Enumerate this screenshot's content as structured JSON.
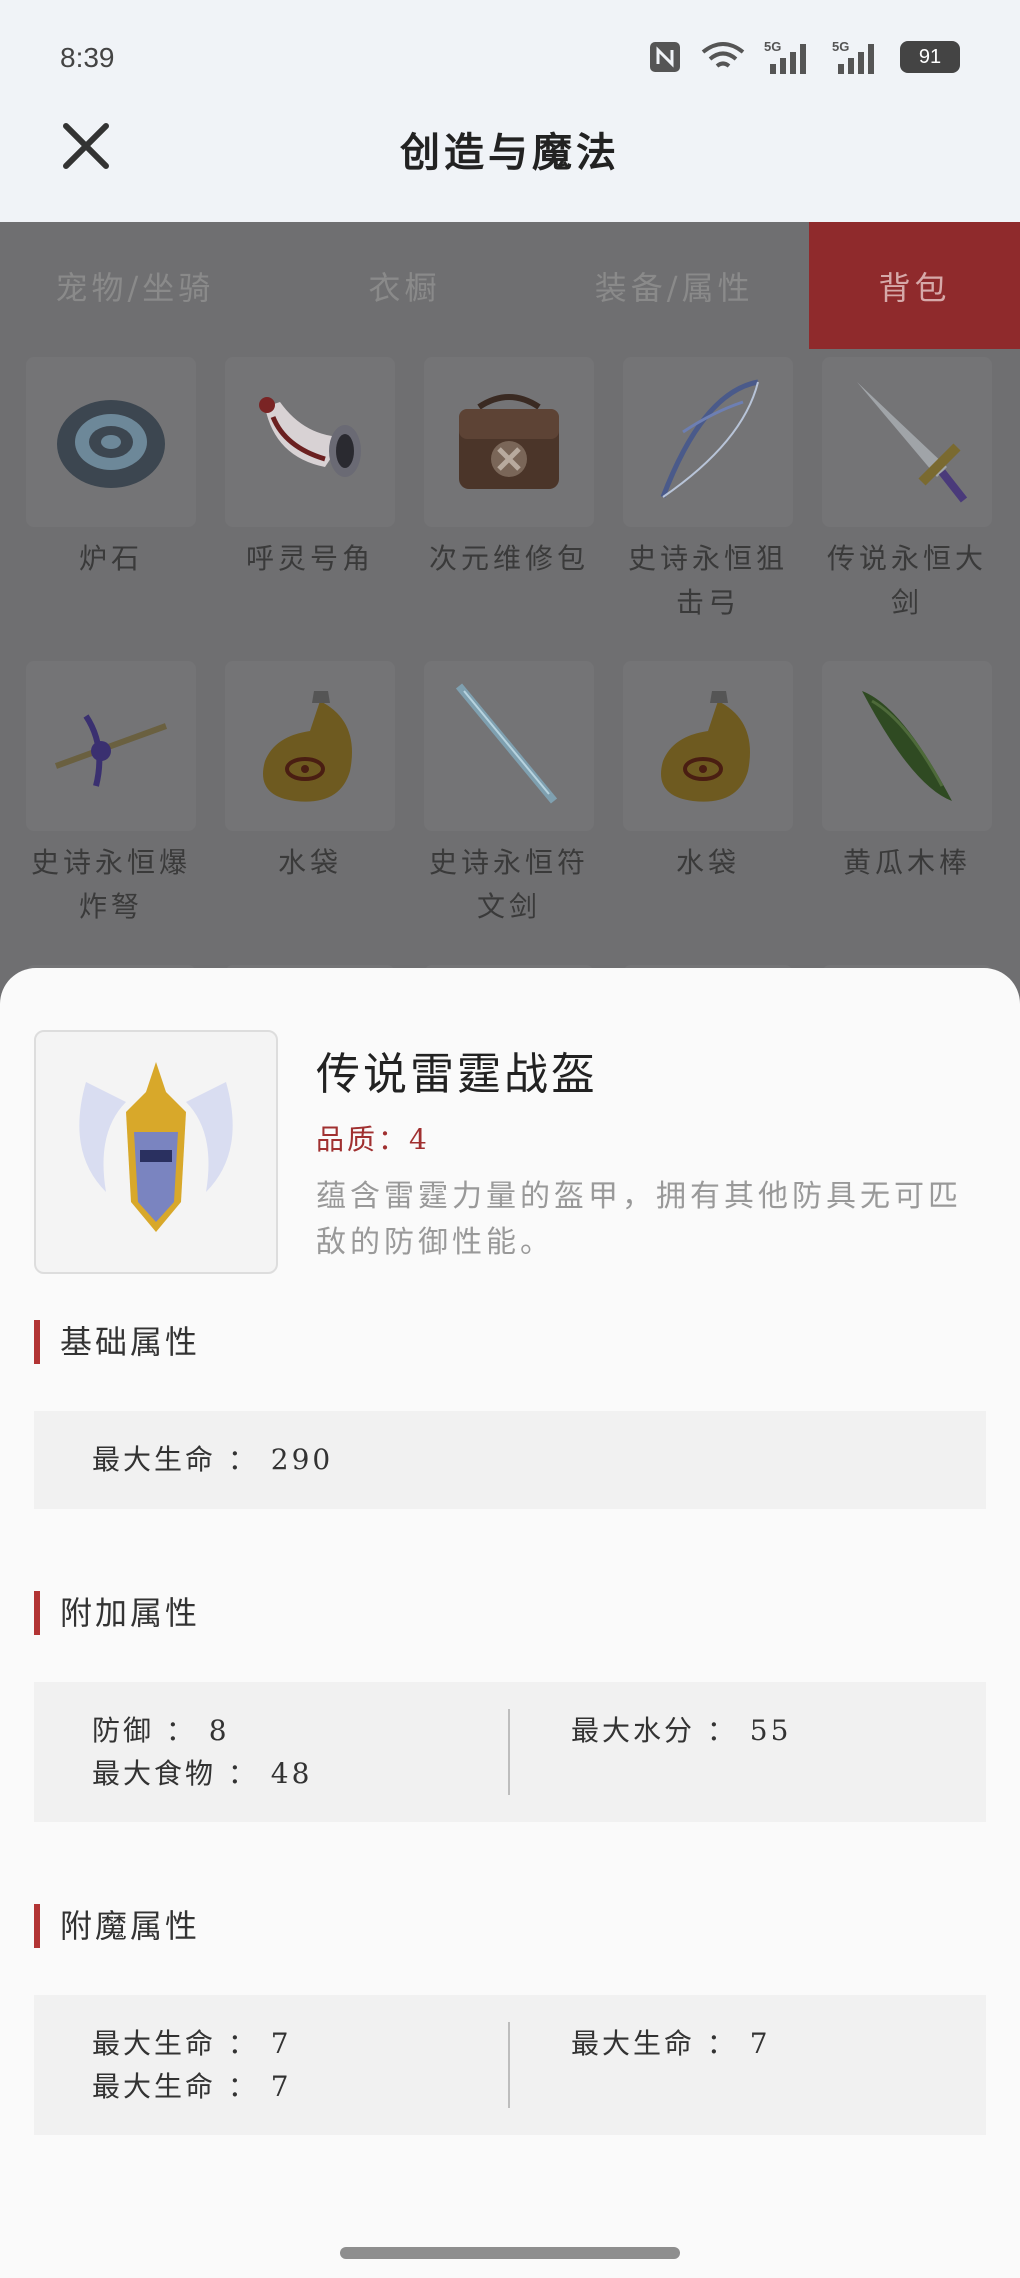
{
  "status": {
    "time": "8:39",
    "battery": "91"
  },
  "header": {
    "title": "创造与魔法"
  },
  "tabs": [
    {
      "label": "宠物/坐骑",
      "active": false
    },
    {
      "label": "衣橱",
      "active": false
    },
    {
      "label": "装备/属性",
      "active": false
    },
    {
      "label": "背包",
      "active": true
    }
  ],
  "items": [
    {
      "label": "炉石",
      "icon": "stone-icon"
    },
    {
      "label": "呼灵号角",
      "icon": "horn-icon"
    },
    {
      "label": "次元维修包",
      "icon": "repair-bag-icon"
    },
    {
      "label": "史诗永恒狙击弓",
      "icon": "bow-icon"
    },
    {
      "label": "传说永恒大剑",
      "icon": "sword-icon"
    },
    {
      "label": "史诗永恒爆炸弩",
      "icon": "crossbow-icon"
    },
    {
      "label": "水袋",
      "icon": "water-bag-icon"
    },
    {
      "label": "史诗永恒符文剑",
      "icon": "rune-sword-icon"
    },
    {
      "label": "水袋",
      "icon": "water-bag-icon"
    },
    {
      "label": "黄瓜木棒",
      "icon": "cucumber-club-icon"
    }
  ],
  "detail": {
    "name": "传说雷霆战盔",
    "quality": "品质：4",
    "description": "蕴含雷霆力量的盔甲，拥有其他防具无可匹敌的防御性能。",
    "sections": {
      "base": {
        "title": "基础属性",
        "left": [
          "最大生命 ： 290"
        ],
        "right": []
      },
      "extra": {
        "title": "附加属性",
        "left": [
          "防御 ： 8",
          "最大食物 ： 48"
        ],
        "right": [
          "最大水分 ： 55"
        ]
      },
      "enchant": {
        "title": "附魔属性",
        "left": [
          "最大生命 ： 7",
          "最大生命 ： 7"
        ],
        "right": [
          "最大生命 ： 7"
        ]
      }
    }
  },
  "colors": {
    "accent": "#8f2a2c",
    "section_bar": "#b23434",
    "quality": "#a03030"
  }
}
